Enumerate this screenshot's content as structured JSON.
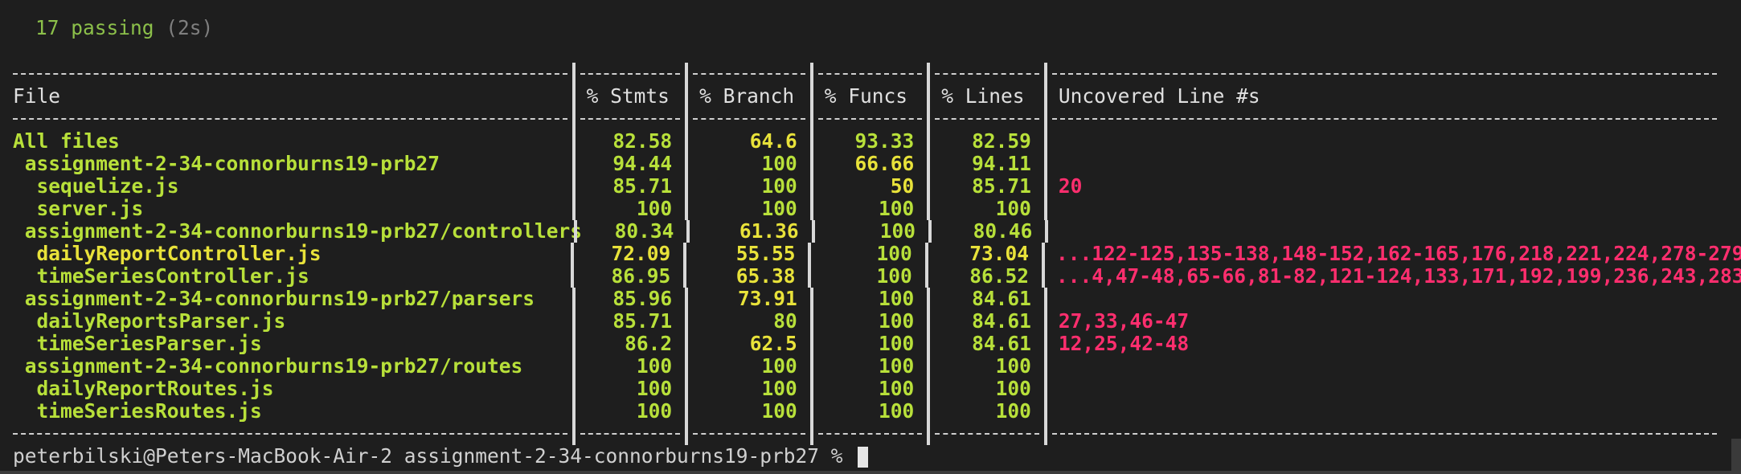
{
  "summary": {
    "passing": "17 passing",
    "duration": "(2s)"
  },
  "coverage": {
    "headers": [
      "File",
      "% Stmts",
      "% Branch",
      "% Funcs",
      "% Lines",
      "Uncovered Line #s"
    ],
    "rows": [
      {
        "file": "All files",
        "stmts": "82.58",
        "branch": "64.6",
        "funcs": "93.33",
        "lines": "82.59",
        "uncovered": "",
        "colors": [
          "g",
          "g",
          "y",
          "g",
          "g"
        ]
      },
      {
        "file": " assignment-2-34-connorburns19-prb27",
        "stmts": "94.44",
        "branch": "100",
        "funcs": "66.66",
        "lines": "94.11",
        "uncovered": "",
        "colors": [
          "g",
          "g",
          "g",
          "y",
          "g"
        ]
      },
      {
        "file": "  sequelize.js",
        "stmts": "85.71",
        "branch": "100",
        "funcs": "50",
        "lines": "85.71",
        "uncovered": "20",
        "colors": [
          "g",
          "g",
          "g",
          "y",
          "g"
        ]
      },
      {
        "file": "  server.js",
        "stmts": "100",
        "branch": "100",
        "funcs": "100",
        "lines": "100",
        "uncovered": "",
        "colors": [
          "g",
          "g",
          "g",
          "g",
          "g"
        ]
      },
      {
        "file": " assignment-2-34-connorburns19-prb27/controllers",
        "stmts": "80.34",
        "branch": "61.36",
        "funcs": "100",
        "lines": "80.46",
        "uncovered": "",
        "colors": [
          "g",
          "g",
          "y",
          "g",
          "g"
        ]
      },
      {
        "file": "  dailyReportController.js",
        "stmts": "72.09",
        "branch": "55.55",
        "funcs": "100",
        "lines": "73.04",
        "uncovered": "...122-125,135-138,148-152,162-165,176,218,221,224,278-279",
        "colors": [
          "y",
          "y",
          "y",
          "g",
          "y"
        ]
      },
      {
        "file": "  timeSeriesController.js",
        "stmts": "86.95",
        "branch": "65.38",
        "funcs": "100",
        "lines": "86.52",
        "uncovered": "...4,47-48,65-66,81-82,121-124,133,171,192,199,236,243,283",
        "colors": [
          "g",
          "g",
          "y",
          "g",
          "g"
        ]
      },
      {
        "file": " assignment-2-34-connorburns19-prb27/parsers",
        "stmts": "85.96",
        "branch": "73.91",
        "funcs": "100",
        "lines": "84.61",
        "uncovered": "",
        "colors": [
          "g",
          "g",
          "y",
          "g",
          "g"
        ]
      },
      {
        "file": "  dailyReportsParser.js",
        "stmts": "85.71",
        "branch": "80",
        "funcs": "100",
        "lines": "84.61",
        "uncovered": "27,33,46-47",
        "colors": [
          "g",
          "g",
          "g",
          "g",
          "g"
        ]
      },
      {
        "file": "  timeSeriesParser.js",
        "stmts": "86.2",
        "branch": "62.5",
        "funcs": "100",
        "lines": "84.61",
        "uncovered": "12,25,42-48",
        "colors": [
          "g",
          "g",
          "y",
          "g",
          "g"
        ]
      },
      {
        "file": " assignment-2-34-connorburns19-prb27/routes",
        "stmts": "100",
        "branch": "100",
        "funcs": "100",
        "lines": "100",
        "uncovered": "",
        "colors": [
          "g",
          "g",
          "g",
          "g",
          "g"
        ]
      },
      {
        "file": "  dailyReportRoutes.js",
        "stmts": "100",
        "branch": "100",
        "funcs": "100",
        "lines": "100",
        "uncovered": "",
        "colors": [
          "g",
          "g",
          "g",
          "g",
          "g"
        ]
      },
      {
        "file": "  timeSeriesRoutes.js",
        "stmts": "100",
        "branch": "100",
        "funcs": "100",
        "lines": "100",
        "uncovered": "",
        "colors": [
          "g",
          "g",
          "g",
          "g",
          "g"
        ]
      }
    ]
  },
  "prompt": {
    "text": "peterbilski@Peters-MacBook-Air-2 assignment-2-34-connorburns19-prb27 %"
  },
  "colors": {
    "background": "#1e1e1e",
    "pass": "#8cc04a",
    "good": "#b8e03a",
    "warn": "#e8e23a",
    "uncovered": "#ff2e6e"
  }
}
